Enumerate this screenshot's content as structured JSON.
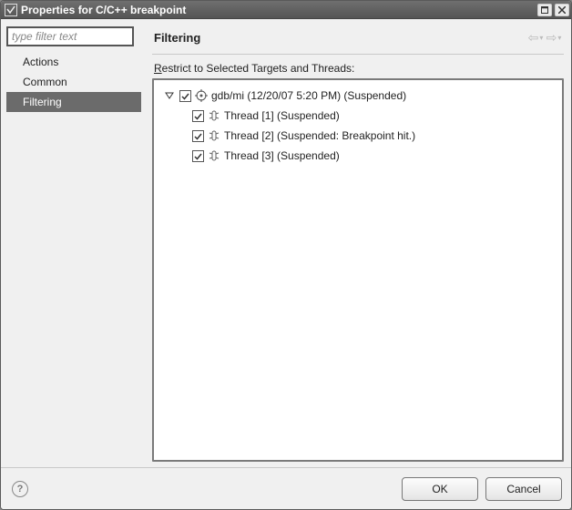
{
  "window": {
    "title": "Properties for C/C++ breakpoint"
  },
  "filter_input": {
    "value": "type filter text"
  },
  "nav": {
    "items": [
      {
        "label": "Actions",
        "selected": false
      },
      {
        "label": "Common",
        "selected": false
      },
      {
        "label": "Filtering",
        "selected": true
      }
    ]
  },
  "page": {
    "title": "Filtering",
    "section_label_prefix": "R",
    "section_label_rest": "estrict to Selected Targets and Threads:"
  },
  "tree": {
    "root": {
      "checked": true,
      "label": "gdb/mi (12/20/07 5:20 PM) (Suspended)",
      "expanded": true,
      "children": [
        {
          "checked": true,
          "label": "Thread [1] (Suspended)"
        },
        {
          "checked": true,
          "label": "Thread [2] (Suspended: Breakpoint hit.)"
        },
        {
          "checked": true,
          "label": "Thread [3] (Suspended)"
        }
      ]
    }
  },
  "buttons": {
    "ok": "OK",
    "cancel": "Cancel"
  }
}
